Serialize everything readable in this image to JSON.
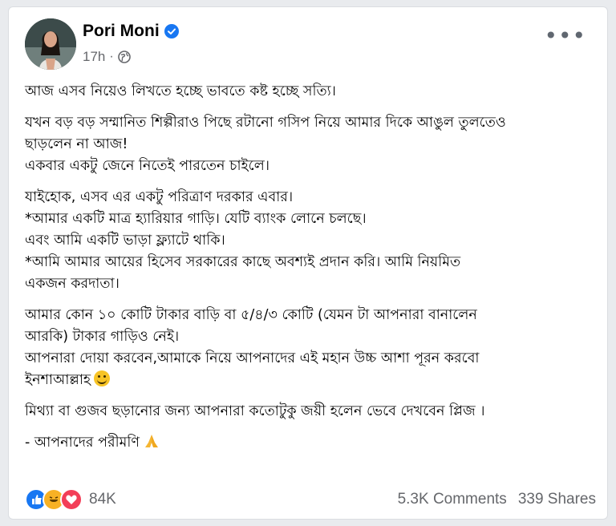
{
  "post": {
    "author": "Pori Moni",
    "timestamp": "17h",
    "paragraphs": [
      [
        "আজ এসব নিয়েও লিখতে হচ্ছে ভাবতে কষ্ট হচ্ছে সত্যি।"
      ],
      [
        "যখন বড় বড় সম্মানিত শিল্পীরাও পিছে রটানো গসিপ নিয়ে আমার দিকে আঙুল তুলতেও",
        "ছাড়লেন না আজ!",
        "একবার একটু জেনে নিতেই পারতেন চাইলে।"
      ],
      [
        "যাইহোক, এসব এর একটু পরিত্রাণ দরকার এবার।",
        "*আমার একটি মাত্র হ্যারিয়ার গাড়ি। যেটি ব্যাংক লোনে চলছে।",
        "এবং আমি একটি ভাড়া ফ্ল্যাটে থাকি।",
        "*আমি আমার আয়ের হিসেব সরকারের কাছে অবশ্যই প্রদান করি। আমি নিয়মিত",
        "একজন করদাতা।"
      ],
      [
        "আমার কোন ১০ কোটি টাকার বাড়ি বা ৫/৪/৩ কোটি (যেমন টা আপনারা বানালেন",
        "আরকি) টাকার গাড়িও নেই।",
        "আপনারা দোয়া করবেন,আমাকে নিয়ে আপনাদের এই মহান উচ্চ আশা পূরন করবো",
        "ইনশাআল্লাহ"
      ],
      [
        "মিথ্যা বা গুজব ছড়ানোর জন্য আপনারা কতোটুকু জয়ী হলেন ভেবে দেখবেন প্লিজ ।"
      ],
      [
        "- আপনাদের পরীমণি"
      ]
    ]
  },
  "stats": {
    "reactions_count": "84K",
    "comments": "5.3K Comments",
    "shares": "339 Shares"
  },
  "icons": [
    "verified-badge-icon",
    "globe-icon",
    "more-options-icon",
    "smile-emoji-icon",
    "pray-emoji-icon",
    "like-reaction-icon",
    "haha-reaction-icon",
    "love-reaction-icon"
  ],
  "colors": {
    "verified": "#1877f2",
    "like": "#1877f2",
    "haha": "#f7b125",
    "love": "#f33e58",
    "secondary_text": "#65676b"
  }
}
